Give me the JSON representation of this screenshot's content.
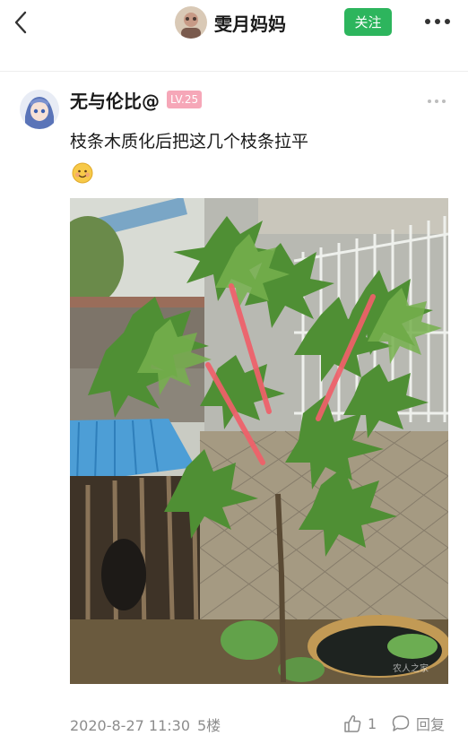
{
  "header": {
    "title": "雯月妈妈",
    "follow_label": "关注",
    "back_icon": "chevron-left-icon",
    "more_icon": "more-dots-icon"
  },
  "post": {
    "author": "无与伦比@",
    "level": "LV.25",
    "text": "枝条木质化后把这几个枝条拉平",
    "emoji": "smiling-face-emoji",
    "photo": {
      "subject": "fig tree photo with red annotation lines",
      "watermark": "农人之家"
    },
    "timestamp": "2020-8-27 11:30",
    "floor": "5楼",
    "like_count": "1",
    "reply_label": "回复"
  },
  "colors": {
    "follow_green": "#2db55d",
    "level_pink": "#f6a7b8",
    "annotation_red": "#f0606a",
    "meta_gray": "#8c8c8c"
  }
}
